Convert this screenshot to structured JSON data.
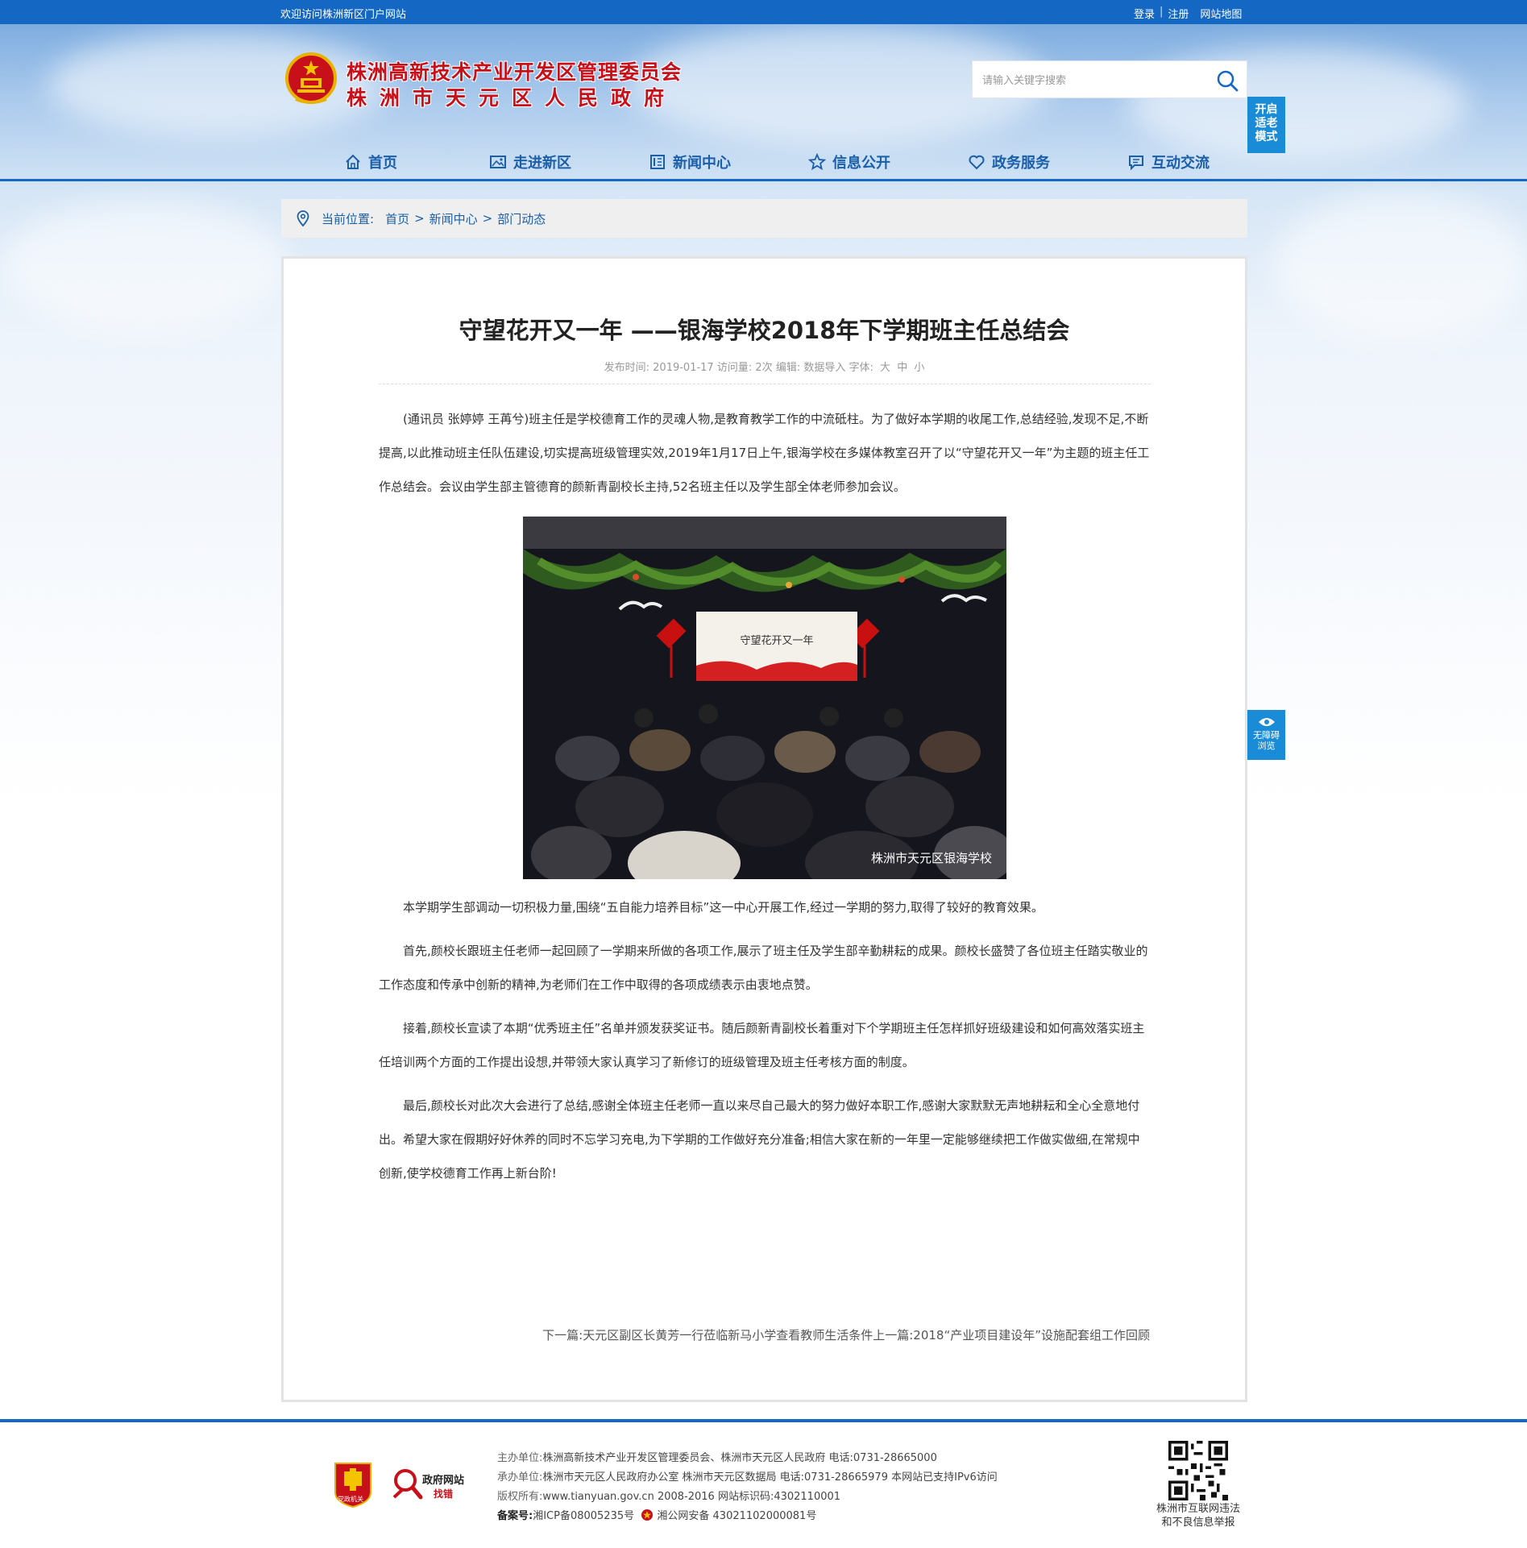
{
  "topbar": {
    "welcome": "欢迎访问株洲新区门户网站",
    "login": "登录",
    "sep": "|",
    "register": "注册",
    "sitemap": "网站地图"
  },
  "header": {
    "title_line1": "株洲高新技术产业开发区管理委员会",
    "title_line2": "株洲市天元区人民政府"
  },
  "search": {
    "placeholder": "请输入关键字搜索"
  },
  "elder_mode": {
    "line1": "开启",
    "line2": "适老",
    "line3": "模式"
  },
  "nav": [
    {
      "label": "首页",
      "icon": "home-icon"
    },
    {
      "label": "走进新区",
      "icon": "picture-icon"
    },
    {
      "label": "新闻中心",
      "icon": "newspaper-icon"
    },
    {
      "label": "信息公开",
      "icon": "star-icon"
    },
    {
      "label": "政务服务",
      "icon": "heart-icon"
    },
    {
      "label": "互动交流",
      "icon": "chat-icon"
    }
  ],
  "breadcrumb": {
    "prefix": "当前位置:",
    "home": "首页",
    "sep1": ">",
    "news": "新闻中心",
    "sep2": ">",
    "current": "部门动态"
  },
  "article": {
    "title": "守望花开又一年 ——银海学校2018年下学期班主任总结会",
    "meta": {
      "published_label": "发布时间:",
      "published": "2019-01-17",
      "views_label": "访问量:",
      "views": "2次",
      "editor_label": "编辑:",
      "editor": "数据导入",
      "font_label": "字体:",
      "font_large": "大",
      "font_medium": "中",
      "font_small": "小"
    },
    "para1": "(通讯员 张婷婷 王苒兮)班主任是学校德育工作的灵魂人物,是教育教学工作的中流砥柱。为了做好本学期的收尾工作,总结经验,发现不足,不断提高,以此推动班主任队伍建设,切实提高班级管理实效,2019年1月17日上午,银海学校在多媒体教室召开了以“守望花开又一年”为主题的班主任工作总结会。会议由学生部主管德育的颜新青副校长主持,52名班主任以及学生部全体老师参加会议。",
    "photo_caption": "株洲市天元区银海学校",
    "photo_screen_text": "守望花开又一年",
    "para2": "本学期学生部调动一切积极力量,围绕“五自能力培养目标”这一中心开展工作,经过一学期的努力,取得了较好的教育效果。",
    "para3": "首先,颜校长跟班主任老师一起回顾了一学期来所做的各项工作,展示了班主任及学生部辛勤耕耘的成果。颜校长盛赞了各位班主任踏实敬业的工作态度和传承中创新的精神,为老师们在工作中取得的各项成绩表示由衷地点赞。",
    "para4": "接着,颜校长宣读了本期“优秀班主任”名单并颁发获奖证书。随后颜新青副校长着重对下个学期班主任怎样抓好班级建设和如何高效落实班主任培训两个方面的工作提出设想,并带领大家认真学习了新修订的班级管理及班主任考核方面的制度。",
    "para5": "最后,颜校长对此次大会进行了总结,感谢全体班主任老师一直以来尽自己最大的努力做好本职工作,感谢大家默默无声地耕耘和全心全意地付出。希望大家在假期好好休养的同时不忘学习充电,为下学期的工作做好充分准备;相信大家在新的一年里一定能够继续把工作做实做细,在常规中创新,使学校德育工作再上新台阶!",
    "next": "下一篇:天元区副区长黄芳一行莅临新马小学查看教师生活条件",
    "prev": "上一篇:2018“产业项目建设年”设施配套组工作回顾"
  },
  "accessibility": {
    "line1": "无障碍",
    "line2": "浏览"
  },
  "footer": {
    "badge1_text": "党政机关",
    "badge2_line1": "政府网站",
    "badge2_line2": "找错",
    "host_label": "主办单位:",
    "host": "株洲高新技术产业开发区管理委员会、株洲市天元区人民政府 电话:0731-28665000",
    "organizer_label": "承办单位:",
    "organizer": "株洲市天元区人民政府办公室 株洲市天元区数据局 电话:0731-28665979 本网站已支持IPv6访问",
    "copyright_label": "版权所有:",
    "copyright": "www.tianyuan.gov.cn 2008-2016 网站标识码:4302110001",
    "icp_label": "备案号:",
    "icp": "湘ICP备08005235号",
    "police": "湘公网安备 43021102000081号",
    "qr_caption_line1": "株洲市互联网违法",
    "qr_caption_line2": "和不良信息举报"
  },
  "colors": {
    "primary_blue": "#1567c4",
    "nav_text": "#1a5fa8",
    "title_red": "#c8101a",
    "float_blue": "#1a8bd6"
  }
}
